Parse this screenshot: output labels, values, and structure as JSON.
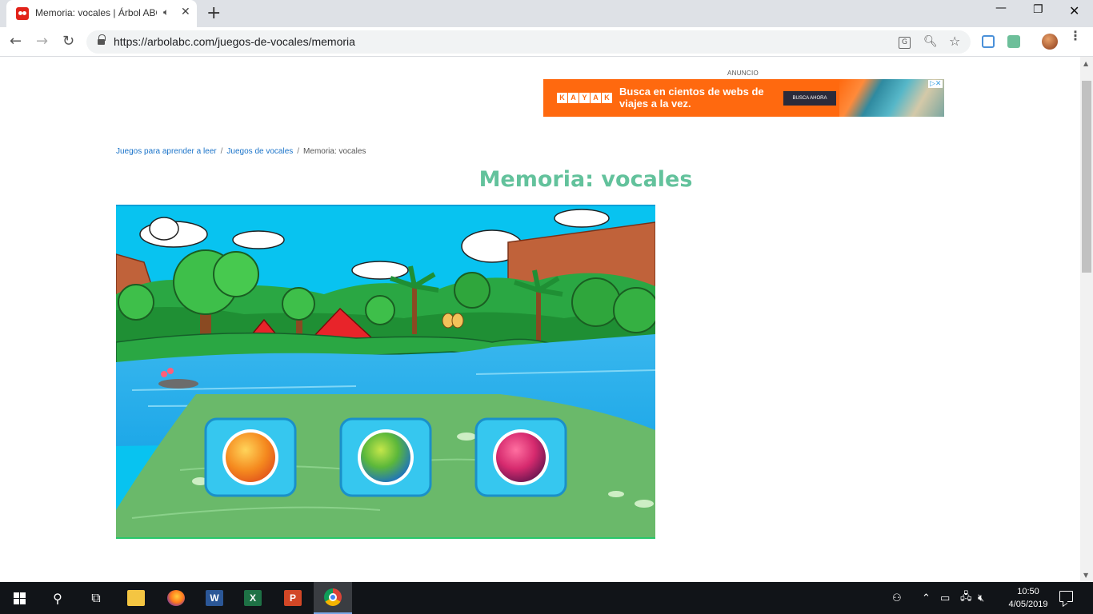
{
  "browser": {
    "tab": {
      "title": "Memoria: vocales | Árbol ABC",
      "audio_icon": "speaker-icon",
      "close_icon": "close-icon"
    },
    "new_tab_icon": "plus-icon",
    "window_controls": {
      "minimize": "—",
      "maximize": "❐",
      "close": "✕"
    },
    "nav": {
      "back": "←",
      "forward": "→",
      "reload": "↻"
    },
    "url": "https://arbolabc.com/juegos-de-vocales/memoria",
    "omnibox_icons": [
      "translate-icon",
      "zoom-icon",
      "star-icon"
    ],
    "extensions": [
      "ext1-icon",
      "ext2-icon"
    ],
    "menu_icon": "⋮"
  },
  "ad": {
    "label": "ANUNCIO",
    "logo_letters": [
      "K",
      "A",
      "Y",
      "A",
      "K"
    ],
    "headline": "Busca en cientos de webs de viajes a la vez.",
    "cta": "BUSCA AHORA",
    "ad_choices": "▷✕",
    "colors": {
      "background": "#ff690f"
    }
  },
  "breadcrumb": {
    "items": [
      {
        "label": "Juegos para aprender a leer",
        "link": true
      },
      {
        "label": "Juegos de vocales",
        "link": true
      },
      {
        "label": "Memoria: vocales",
        "link": false
      }
    ],
    "separator": "/"
  },
  "page": {
    "title": "Memoria: vocales",
    "title_color": "#63c29c"
  },
  "game": {
    "level_buttons": [
      {
        "name": "orange-level-button",
        "color": "#f58a1f"
      },
      {
        "name": "green-blue-level-button",
        "color": "#5cb83a"
      },
      {
        "name": "pink-level-button",
        "color": "#d62a6e"
      }
    ]
  },
  "taskbar": {
    "apps": [
      "start-button",
      "search-button",
      "task-view-button",
      "file-explorer",
      "firefox",
      "word",
      "excel",
      "powerpoint",
      "chrome"
    ],
    "word_letter": "W",
    "excel_letter": "X",
    "ppt_letter": "P",
    "tray": {
      "people": "⚇",
      "chevron": "⌃",
      "battery": "▭",
      "network": "🖧",
      "volume": "🔇︎"
    },
    "time": "10:50",
    "date": "4/05/2019"
  }
}
